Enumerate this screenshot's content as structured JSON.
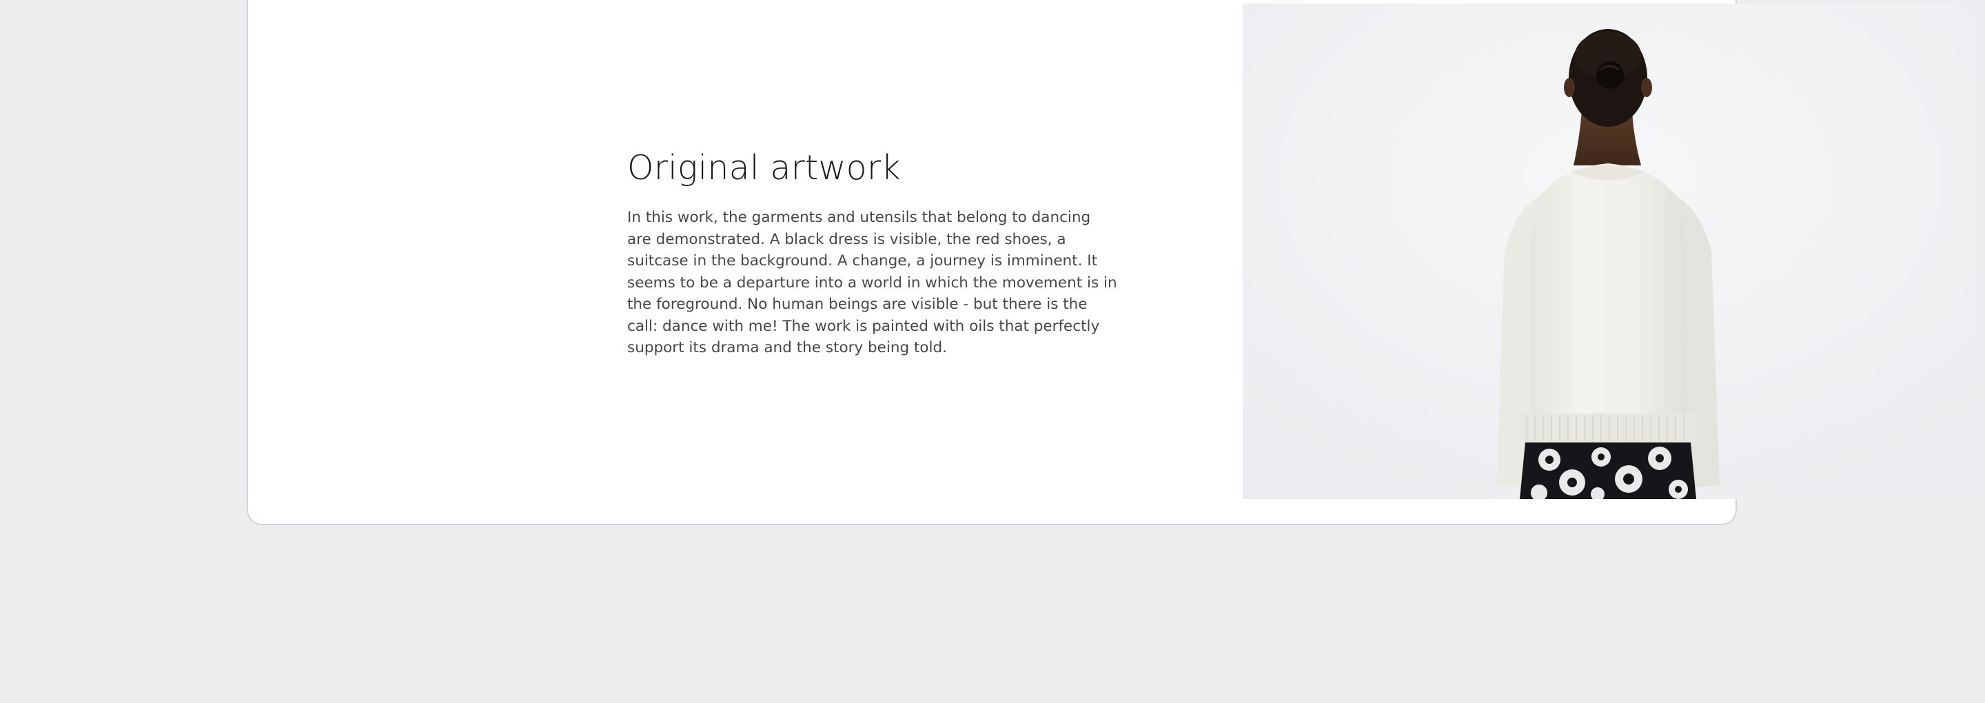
{
  "artwork": {
    "title": "Original artwork",
    "description": "In this work, the garments and utensils that belong to dancing are demonstrated. A black dress is visible, the red shoes, a suitcase in the background. A change, a journey is imminent. It seems to be a departure into a world in which the movement is in the foreground. No human beings are visible - but there is the call: dance with me! The work is painted with oils that perfectly support its drama and the story being told."
  },
  "image": {
    "subject": "model-back-view-white-sweater-floral-skirt"
  },
  "colors": {
    "page_background": "#ecedef",
    "card_background": "#ffffff",
    "title_text": "#1b1b1f",
    "body_text": "#45464d"
  }
}
